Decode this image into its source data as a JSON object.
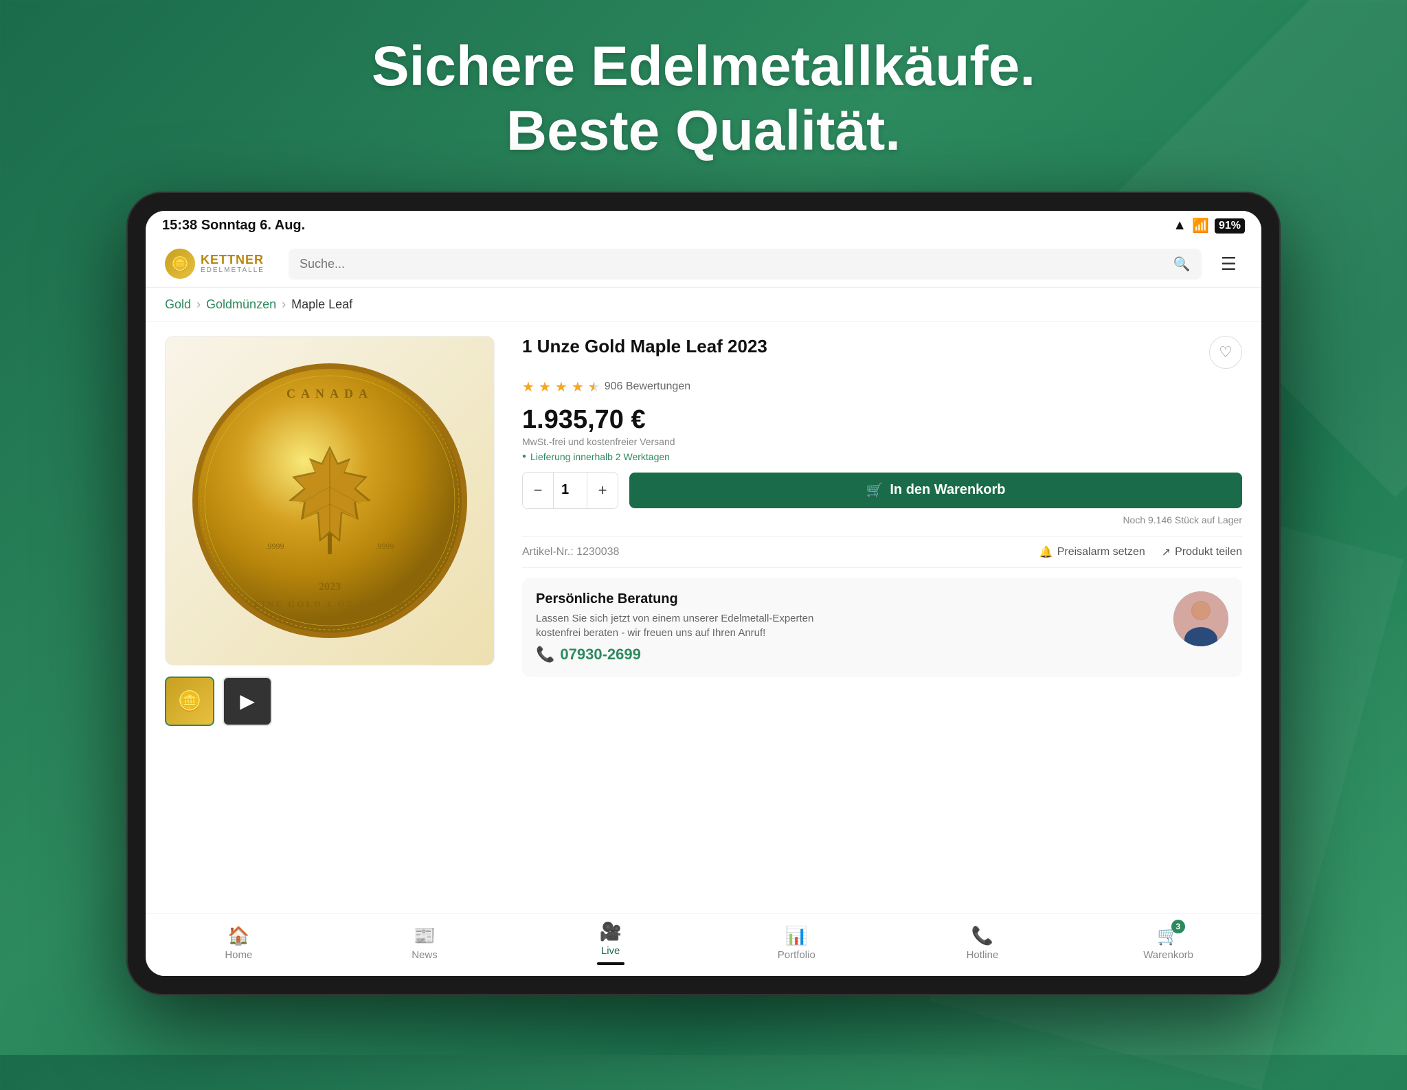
{
  "page": {
    "headline_line1": "Sichere Edelmetallkäufe.",
    "headline_line2": "Beste Qualität."
  },
  "status_bar": {
    "time": "15:38",
    "date": "Sonntag 6. Aug.",
    "wifi": "wifi",
    "signal": "signal",
    "battery_pct": "91%"
  },
  "navbar": {
    "logo_icon": "🪙",
    "brand_name": "KETTNER",
    "brand_sub": "EDELMETALLE",
    "search_placeholder": "Suche..."
  },
  "breadcrumb": {
    "items": [
      "Gold",
      "Goldmünzen",
      "Maple Leaf"
    ]
  },
  "product": {
    "title": "1 Unze Gold Maple Leaf 2023",
    "rating": 4.5,
    "review_count": "906 Bewertungen",
    "price": "1.935,70 €",
    "price_note": "MwSt.-frei und kostenfreier Versand",
    "delivery": "Lieferung innerhalb 2 Werktagen",
    "quantity": 1,
    "add_to_cart_label": "In den Warenkorb",
    "stock_note": "Noch 9.146 Stück auf Lager",
    "article_label": "Artikel-Nr.:",
    "article_nr": "1230038",
    "price_alert_label": "Preisalarm setzen",
    "share_label": "Produkt teilen"
  },
  "consultation": {
    "title": "Persönliche Beratung",
    "desc": "Lassen Sie sich jetzt von einem unserer Edelmetall-Experten\nkostenfrei beraten - wir freuen uns auf Ihren Anruf!",
    "phone": "07930-2699"
  },
  "bottom_nav": {
    "items": [
      {
        "id": "home",
        "icon": "🏠",
        "label": "Home",
        "active": false
      },
      {
        "id": "news",
        "icon": "📰",
        "label": "News",
        "active": false
      },
      {
        "id": "live",
        "icon": "🎥",
        "label": "Live",
        "active": true
      },
      {
        "id": "portfolio",
        "icon": "📊",
        "label": "Portfolio",
        "active": false
      },
      {
        "id": "hotline",
        "icon": "📞",
        "label": "Hotline",
        "active": false
      },
      {
        "id": "warenkorb",
        "icon": "🛒",
        "label": "Warenkorb",
        "active": false,
        "badge": "3"
      }
    ]
  }
}
